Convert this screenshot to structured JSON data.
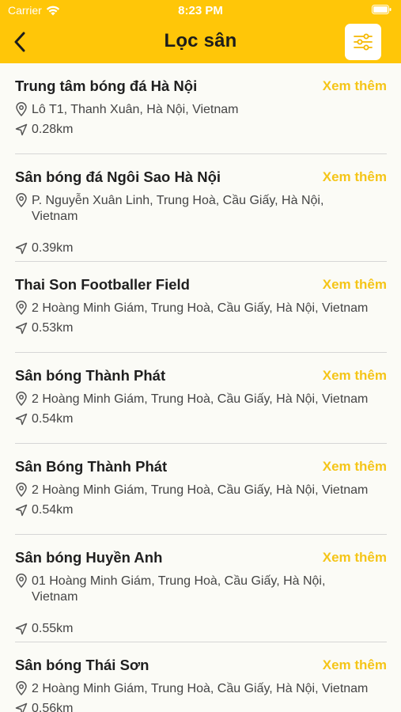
{
  "status_bar": {
    "carrier": "Carrier",
    "time": "8:23 PM"
  },
  "nav": {
    "title": "Lọc sân"
  },
  "colors": {
    "accent": "#ffc608",
    "link": "#f5c518"
  },
  "icons": {
    "back": "chevron-left-icon",
    "filter": "sliders-icon",
    "address": "map-pin-icon",
    "distance": "navigation-arrow-icon"
  },
  "fields": [
    {
      "name": "Trung tâm bóng đá Hà Nội",
      "more": "Xem thêm",
      "address": "Lô T1, Thanh Xuân, Hà Nội, Vietnam",
      "distance": "0.28km"
    },
    {
      "name": "Sân bóng đá Ngôi Sao Hà Nội",
      "more": "Xem thêm",
      "address": "P. Nguyễn Xuân Linh, Trung Hoà, Cầu Giấy, Hà Nội,\nVietnam",
      "distance": "0.39km"
    },
    {
      "name": "Thai Son Footballer Field",
      "more": "Xem thêm",
      "address": "2 Hoàng Minh Giám, Trung Hoà, Cầu Giấy, Hà Nội, Vietnam",
      "distance": "0.53km"
    },
    {
      "name": "Sân bóng Thành Phát",
      "more": "Xem thêm",
      "address": "2 Hoàng Minh Giám, Trung Hoà, Cầu Giấy, Hà Nội, Vietnam",
      "distance": "0.54km"
    },
    {
      "name": "Sân Bóng Thành Phát",
      "more": "Xem thêm",
      "address": "2 Hoàng Minh Giám, Trung Hoà, Cầu Giấy, Hà Nội, Vietnam",
      "distance": "0.54km"
    },
    {
      "name": "Sân bóng Huyền Anh",
      "more": "Xem thêm",
      "address": "01 Hoàng Minh Giám, Trung Hoà, Cầu Giấy, Hà Nội,\nVietnam",
      "distance": "0.55km"
    },
    {
      "name": "Sân bóng Thái Sơn",
      "more": "Xem thêm",
      "address": "2 Hoàng Minh Giám, Trung Hoà, Cầu Giấy, Hà Nội, Vietnam",
      "distance": "0.56km"
    }
  ]
}
